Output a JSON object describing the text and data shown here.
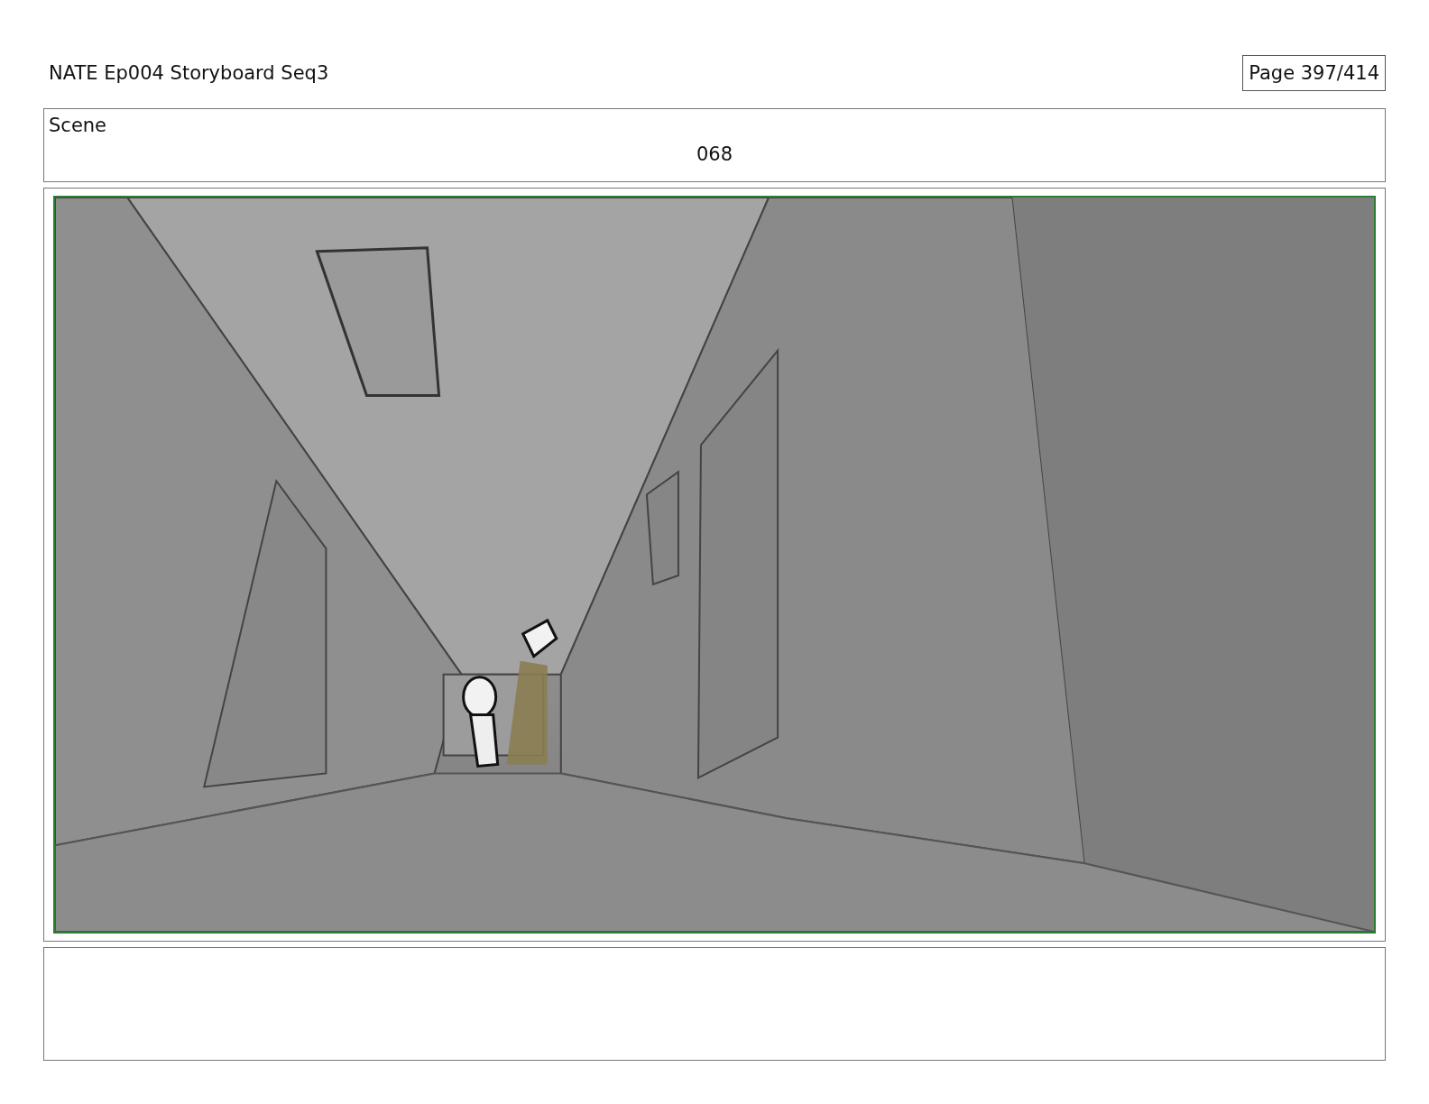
{
  "header": {
    "title": "NATE Ep004 Storyboard Seq3",
    "page": "Page 397/414"
  },
  "scene": {
    "label": "Scene",
    "number": "068"
  }
}
